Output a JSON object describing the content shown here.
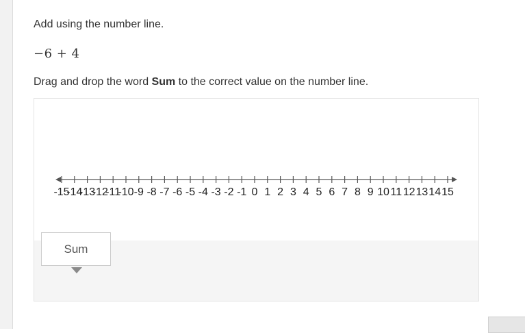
{
  "question": {
    "prompt": "Add using the number line.",
    "expression": "−6 + 4",
    "instruction_before": "Drag and drop the word ",
    "instruction_bold": "Sum",
    "instruction_after": " to the correct value on the number line."
  },
  "number_line": {
    "min": -15,
    "max": 15,
    "step": 1,
    "labels": [
      "-15",
      "-14",
      "-13",
      "-12",
      "-11",
      "-10",
      "-9",
      "-8",
      "-7",
      "-6",
      "-5",
      "-4",
      "-3",
      "-2",
      "-1",
      "0",
      "1",
      "2",
      "3",
      "4",
      "5",
      "6",
      "7",
      "8",
      "9",
      "10",
      "11",
      "12",
      "13",
      "14",
      "15"
    ],
    "line_color": "#555555"
  },
  "draggable": {
    "label": "Sum"
  },
  "colors": {
    "text": "#333333",
    "bank_background": "#f5f5f5",
    "border": "#e3e3e3"
  }
}
